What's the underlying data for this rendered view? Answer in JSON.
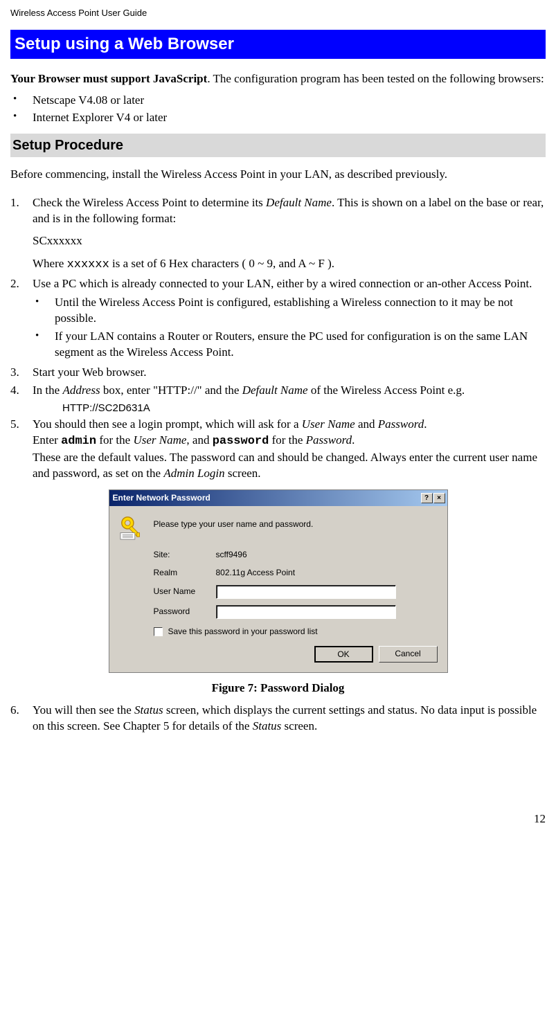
{
  "header": "Wireless Access Point User Guide",
  "blue_banner": "Setup using a Web Browser",
  "intro_bold": "Your Browser must support JavaScript",
  "intro_rest": ". The configuration program has been tested on the following browsers:",
  "browsers": [
    "Netscape V4.08 or later",
    "Internet Explorer V4 or later"
  ],
  "gray_banner": "Setup Procedure",
  "before_text": "Before commencing, install the Wireless Access Point in your LAN, as described previously.",
  "step1_a": "Check the Wireless Access Point to determine its ",
  "step1_default_name": "Default Name",
  "step1_b": ". This is shown on a label on the base or rear, and is in the following format:",
  "scxxx": "SCxxxxxx",
  "where_a": "Where ",
  "where_mono": "xxxxxx",
  "where_b": " is a set of 6 Hex characters ( 0 ~ 9, and A ~ F ).",
  "step2": "Use a PC which is already connected to your LAN, either by a wired connection or an-other Access Point.",
  "step2_sub": [
    "Until the Wireless Access Point is configured, establishing a Wireless connection to it may be not possible.",
    "If your LAN contains a Router or Routers, ensure the PC used for configuration is on the same LAN segment as the Wireless Access Point."
  ],
  "step3": "Start your Web browser.",
  "step4_a": "In the ",
  "step4_address": "Address",
  "step4_b": " box, enter \"HTTP://\" and the ",
  "step4_default_name": "Default Name",
  "step4_c": " of the Wireless Access Point e.g.",
  "http_example": "HTTP://SC2D631A",
  "step5_a": "You should then see a login prompt, which will ask for a ",
  "step5_user": "User Name",
  "step5_b": " and ",
  "step5_pass": "Password",
  "step5_c": ".",
  "step5_d": "Enter ",
  "step5_admin": "admin",
  "step5_e": " for the ",
  "step5_user2": "User Name",
  "step5_f": ", and ",
  "step5_password": "password",
  "step5_g": " for the ",
  "step5_pass2": "Password",
  "step5_h": ".",
  "step5_i": "These are the default values. The password can and should be changed. Always enter the current user name and password, as set on the ",
  "step5_admin_login": "Admin Login",
  "step5_j": " screen.",
  "dialog": {
    "title": "Enter Network Password",
    "help_btn": "?",
    "close_btn": "×",
    "prompt": "Please type your user name and password.",
    "site_label": "Site:",
    "site_value": "scff9496",
    "realm_label": "Realm",
    "realm_value": "802.11g Access Point",
    "user_label": "User Name",
    "pass_label": "Password",
    "save_check": "Save this password in your password list",
    "ok": "OK",
    "cancel": "Cancel"
  },
  "figure_caption": "Figure 7:  Password Dialog",
  "step6_a": "You will then see the ",
  "step6_status1": "Status",
  "step6_b": " screen, which displays the current settings and status. No data input is possible on this screen. See Chapter 5 for details of the ",
  "step6_status2": "Status",
  "step6_c": " screen.",
  "page_number": "12"
}
